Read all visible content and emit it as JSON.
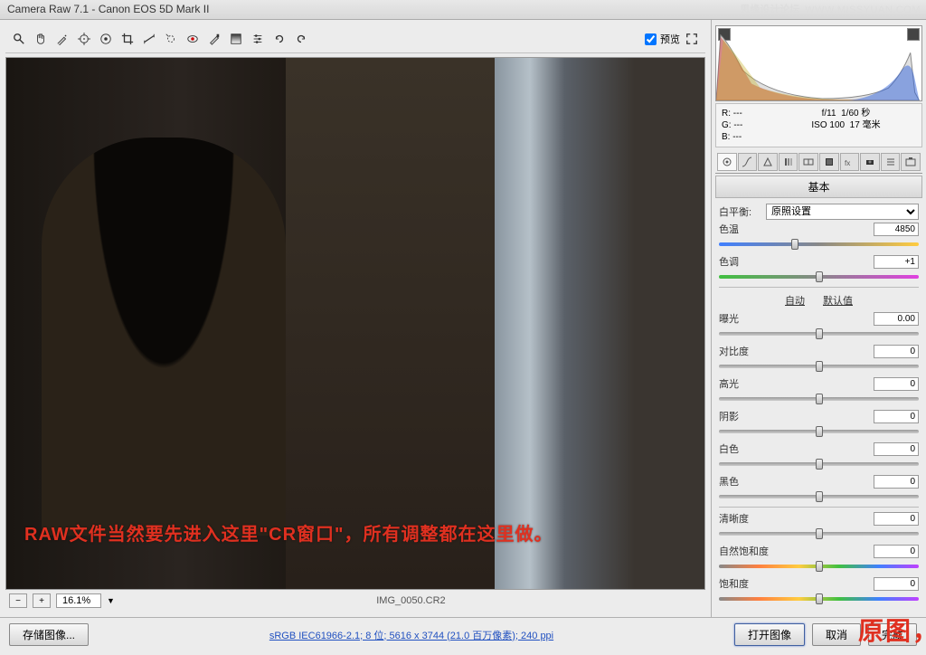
{
  "title": "Camera Raw 7.1  -  Canon EOS 5D Mark II",
  "watermark_zh": "思缘设计论坛",
  "watermark_en": "WWW.MISSYUAN.COM",
  "preview_label": "预览",
  "zoom": {
    "value": "16.1%"
  },
  "filename": "IMG_0050.CR2",
  "annotation1": "RAW文件当然要先进入这里\"CR窗口\"，所有调整都在这里做。",
  "annotation2": "原图，未作修改",
  "meta": {
    "r": "R:  ---",
    "g": "G:  ---",
    "b": "B:  ---",
    "aperture": "f/11",
    "shutter": "1/60 秒",
    "iso": "ISO 100",
    "focal": "17 毫米"
  },
  "panel_title": "基本",
  "wb": {
    "label": "白平衡:",
    "value": "原照设置"
  },
  "sliders": {
    "temp": {
      "label": "色温",
      "value": "4850",
      "pos": 38
    },
    "tint": {
      "label": "色调",
      "value": "+1",
      "pos": 50
    },
    "exposure": {
      "label": "曝光",
      "value": "0.00",
      "pos": 50
    },
    "contrast": {
      "label": "对比度",
      "value": "0",
      "pos": 50
    },
    "highlights": {
      "label": "高光",
      "value": "0",
      "pos": 50
    },
    "shadows": {
      "label": "阴影",
      "value": "0",
      "pos": 50
    },
    "whites": {
      "label": "白色",
      "value": "0",
      "pos": 50
    },
    "blacks": {
      "label": "黑色",
      "value": "0",
      "pos": 50
    },
    "clarity": {
      "label": "清晰度",
      "value": "0",
      "pos": 50
    },
    "vibrance": {
      "label": "自然饱和度",
      "value": "0",
      "pos": 50
    },
    "saturation": {
      "label": "饱和度",
      "value": "0",
      "pos": 50
    }
  },
  "auto_label": "自动",
  "default_label": "默认值",
  "buttons": {
    "save_image": "存储图像...",
    "open_image": "打开图像",
    "cancel": "取消",
    "done": "完成"
  },
  "bottom_link": "sRGB IEC61966-2.1; 8 位; 5616 x 3744 (21.0 百万像素); 240 ppi"
}
